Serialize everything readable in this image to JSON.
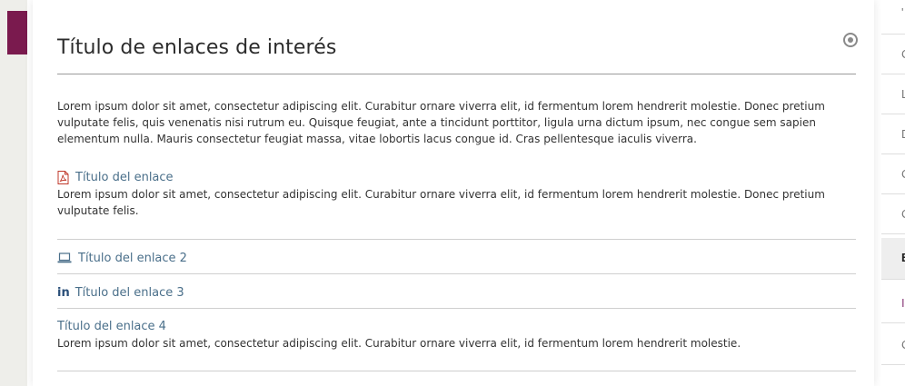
{
  "widget": {
    "title": "Título de enlaces de interés",
    "intro": "Lorem ipsum dolor sit amet, consectetur adipiscing elit. Curabitur ornare viverra elit, id fermentum lorem hendrerit molestie. Donec pretium vulputate felis, quis venenatis nisi rutrum eu. Quisque feugiat, ante a tincidunt porttitor, ligula urna dictum ipsum, nec congue sem sapien elementum nulla. Mauris consectetur feugiat massa, vitae lobortis lacus congue id. Cras pellentesque iaculis viverra."
  },
  "links": [
    {
      "label": "Título del enlace",
      "icon": "pdf-icon",
      "desc": "Lorem ipsum dolor sit amet, consectetur adipiscing elit. Curabitur ornare viverra elit, id fermentum lorem hendrerit molestie. Donec pretium vulputate felis."
    },
    {
      "label": "Título del enlace 2",
      "icon": "laptop-icon",
      "desc": ""
    },
    {
      "label": "Título del enlace 3",
      "icon": "linkedin-icon",
      "icon_text": "in",
      "desc": ""
    },
    {
      "label": "Título del enlace 4",
      "icon": "",
      "desc": "Lorem ipsum dolor sit amet, consectetur adipiscing elit. Curabitur ornare viverra elit, id fermentum lorem hendrerit molestie."
    }
  ],
  "right_panel": {
    "items": [
      "'",
      "C",
      "L",
      "D",
      "C",
      "C",
      "E",
      "I",
      "C"
    ]
  },
  "colors": {
    "accent": "#7a1a4e",
    "link": "#4a6f8a",
    "pdf_icon": "#c0392b",
    "linkedin": "#2a4f79"
  }
}
